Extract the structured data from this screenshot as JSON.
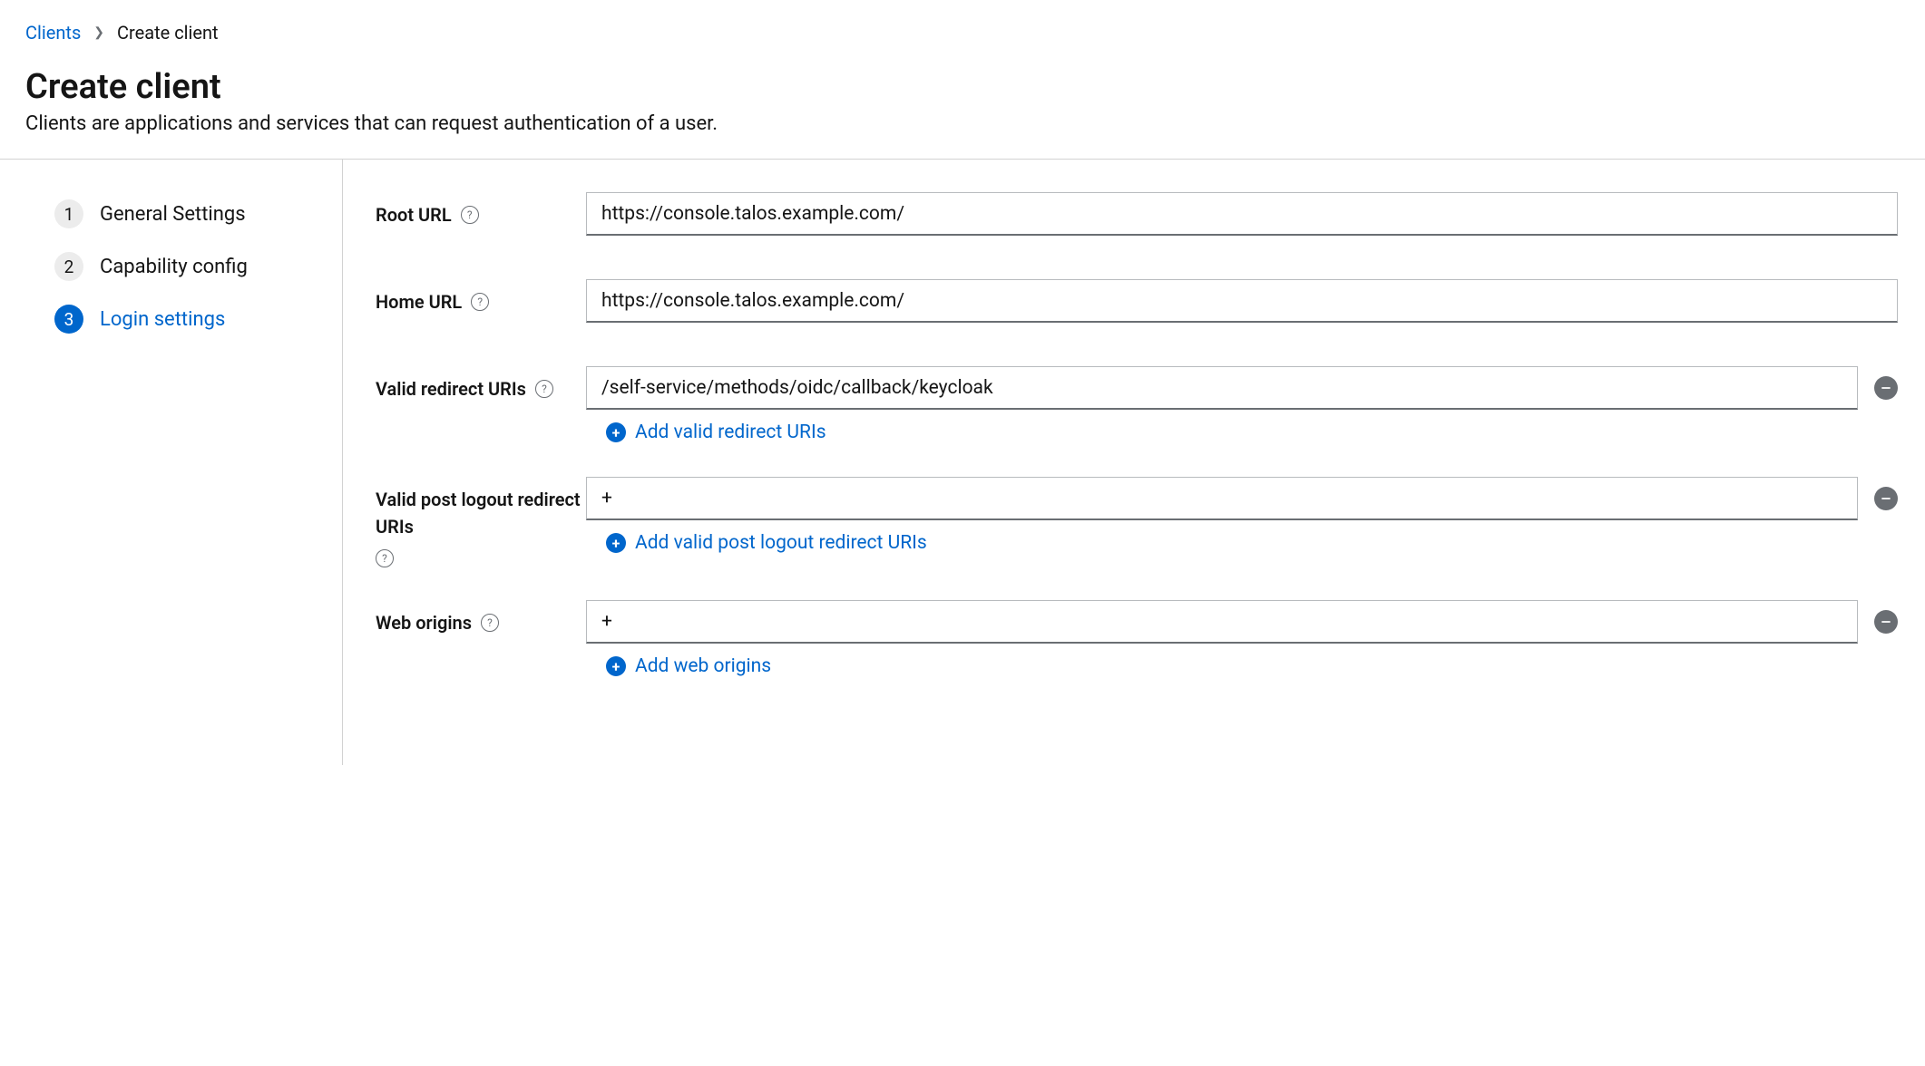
{
  "breadcrumb": {
    "parent": "Clients",
    "current": "Create client"
  },
  "header": {
    "title": "Create client",
    "subtitle": "Clients are applications and services that can request authentication of a user."
  },
  "steps": [
    {
      "num": "1",
      "label": "General Settings"
    },
    {
      "num": "2",
      "label": "Capability config"
    },
    {
      "num": "3",
      "label": "Login settings"
    }
  ],
  "form": {
    "root_url": {
      "label": "Root URL",
      "value": "https://console.talos.example.com/"
    },
    "home_url": {
      "label": "Home URL",
      "value": "https://console.talos.example.com/"
    },
    "redirect_uris": {
      "label": "Valid redirect URIs",
      "value": "/self-service/methods/oidc/callback/keycloak",
      "add_label": "Add valid redirect URIs"
    },
    "post_logout": {
      "label": "Valid post logout redirect URIs",
      "value": "+",
      "add_label": "Add valid post logout redirect URIs"
    },
    "web_origins": {
      "label": "Web origins",
      "value": "+",
      "add_label": "Add web origins"
    }
  }
}
